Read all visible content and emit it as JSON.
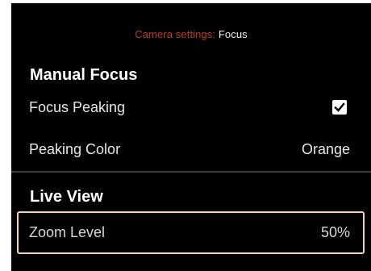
{
  "header": {
    "crumb": "Camera settings:",
    "current": "Focus"
  },
  "sections": [
    {
      "title": "Manual Focus",
      "rows": [
        {
          "label": "Focus Peaking",
          "control": "checkbox",
          "checked": true
        },
        {
          "label": "Peaking Color",
          "value": "Orange"
        }
      ]
    },
    {
      "title": "Live View",
      "rows": [
        {
          "label": "Zoom Level",
          "value": "50%",
          "selected": true
        }
      ]
    }
  ],
  "colors": {
    "background": "#000000",
    "crumb": "#c03a1f",
    "selection_border": "#f4d3b4"
  },
  "icons": {
    "checkbox": "check-icon"
  }
}
